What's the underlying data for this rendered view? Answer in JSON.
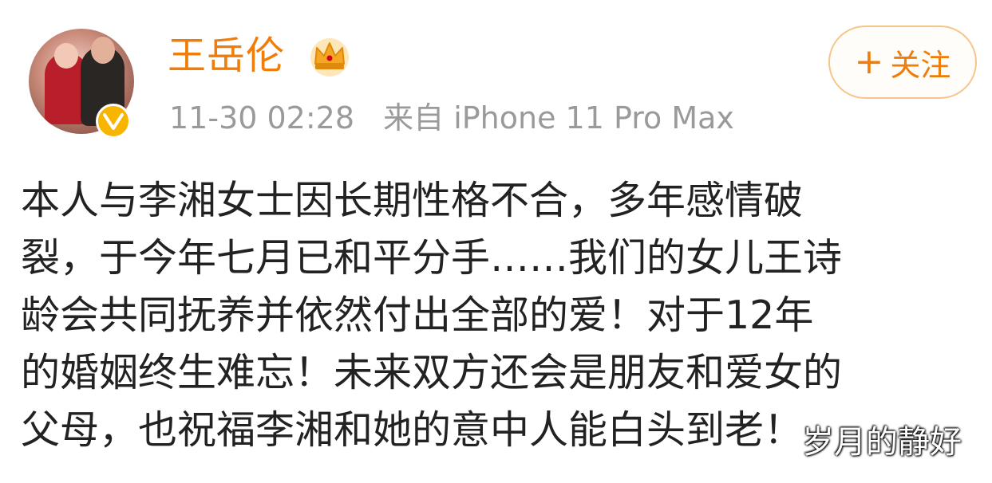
{
  "post": {
    "author": {
      "name": "王岳伦",
      "avatar_icon": "avatar-photo",
      "verified_icon": "verified-v-badge-icon",
      "level_icon": "crown-icon"
    },
    "timestamp": "11-30 02:28",
    "source": "来自 iPhone 11 Pro Max",
    "follow_button": {
      "plus": "+",
      "label": "关注"
    },
    "body_lines": [
      "本人与李湘女士因长期性格不合，多年感情破",
      "裂，于今年七月已和平分手……我们的女儿王诗",
      "龄会共同抚养并依然付出全部的爱！对于12年",
      "的婚姻终生难忘！未来双方还会是朋友和爱女的",
      "父母，也祝福李湘和她的意中人能白头到老！"
    ]
  },
  "watermark": "岁月的静好",
  "colors": {
    "name": "#f07d0a",
    "meta": "#9a9a9a",
    "body": "#222222",
    "follow_border": "#f6c58b",
    "badge": "#f7b500"
  }
}
